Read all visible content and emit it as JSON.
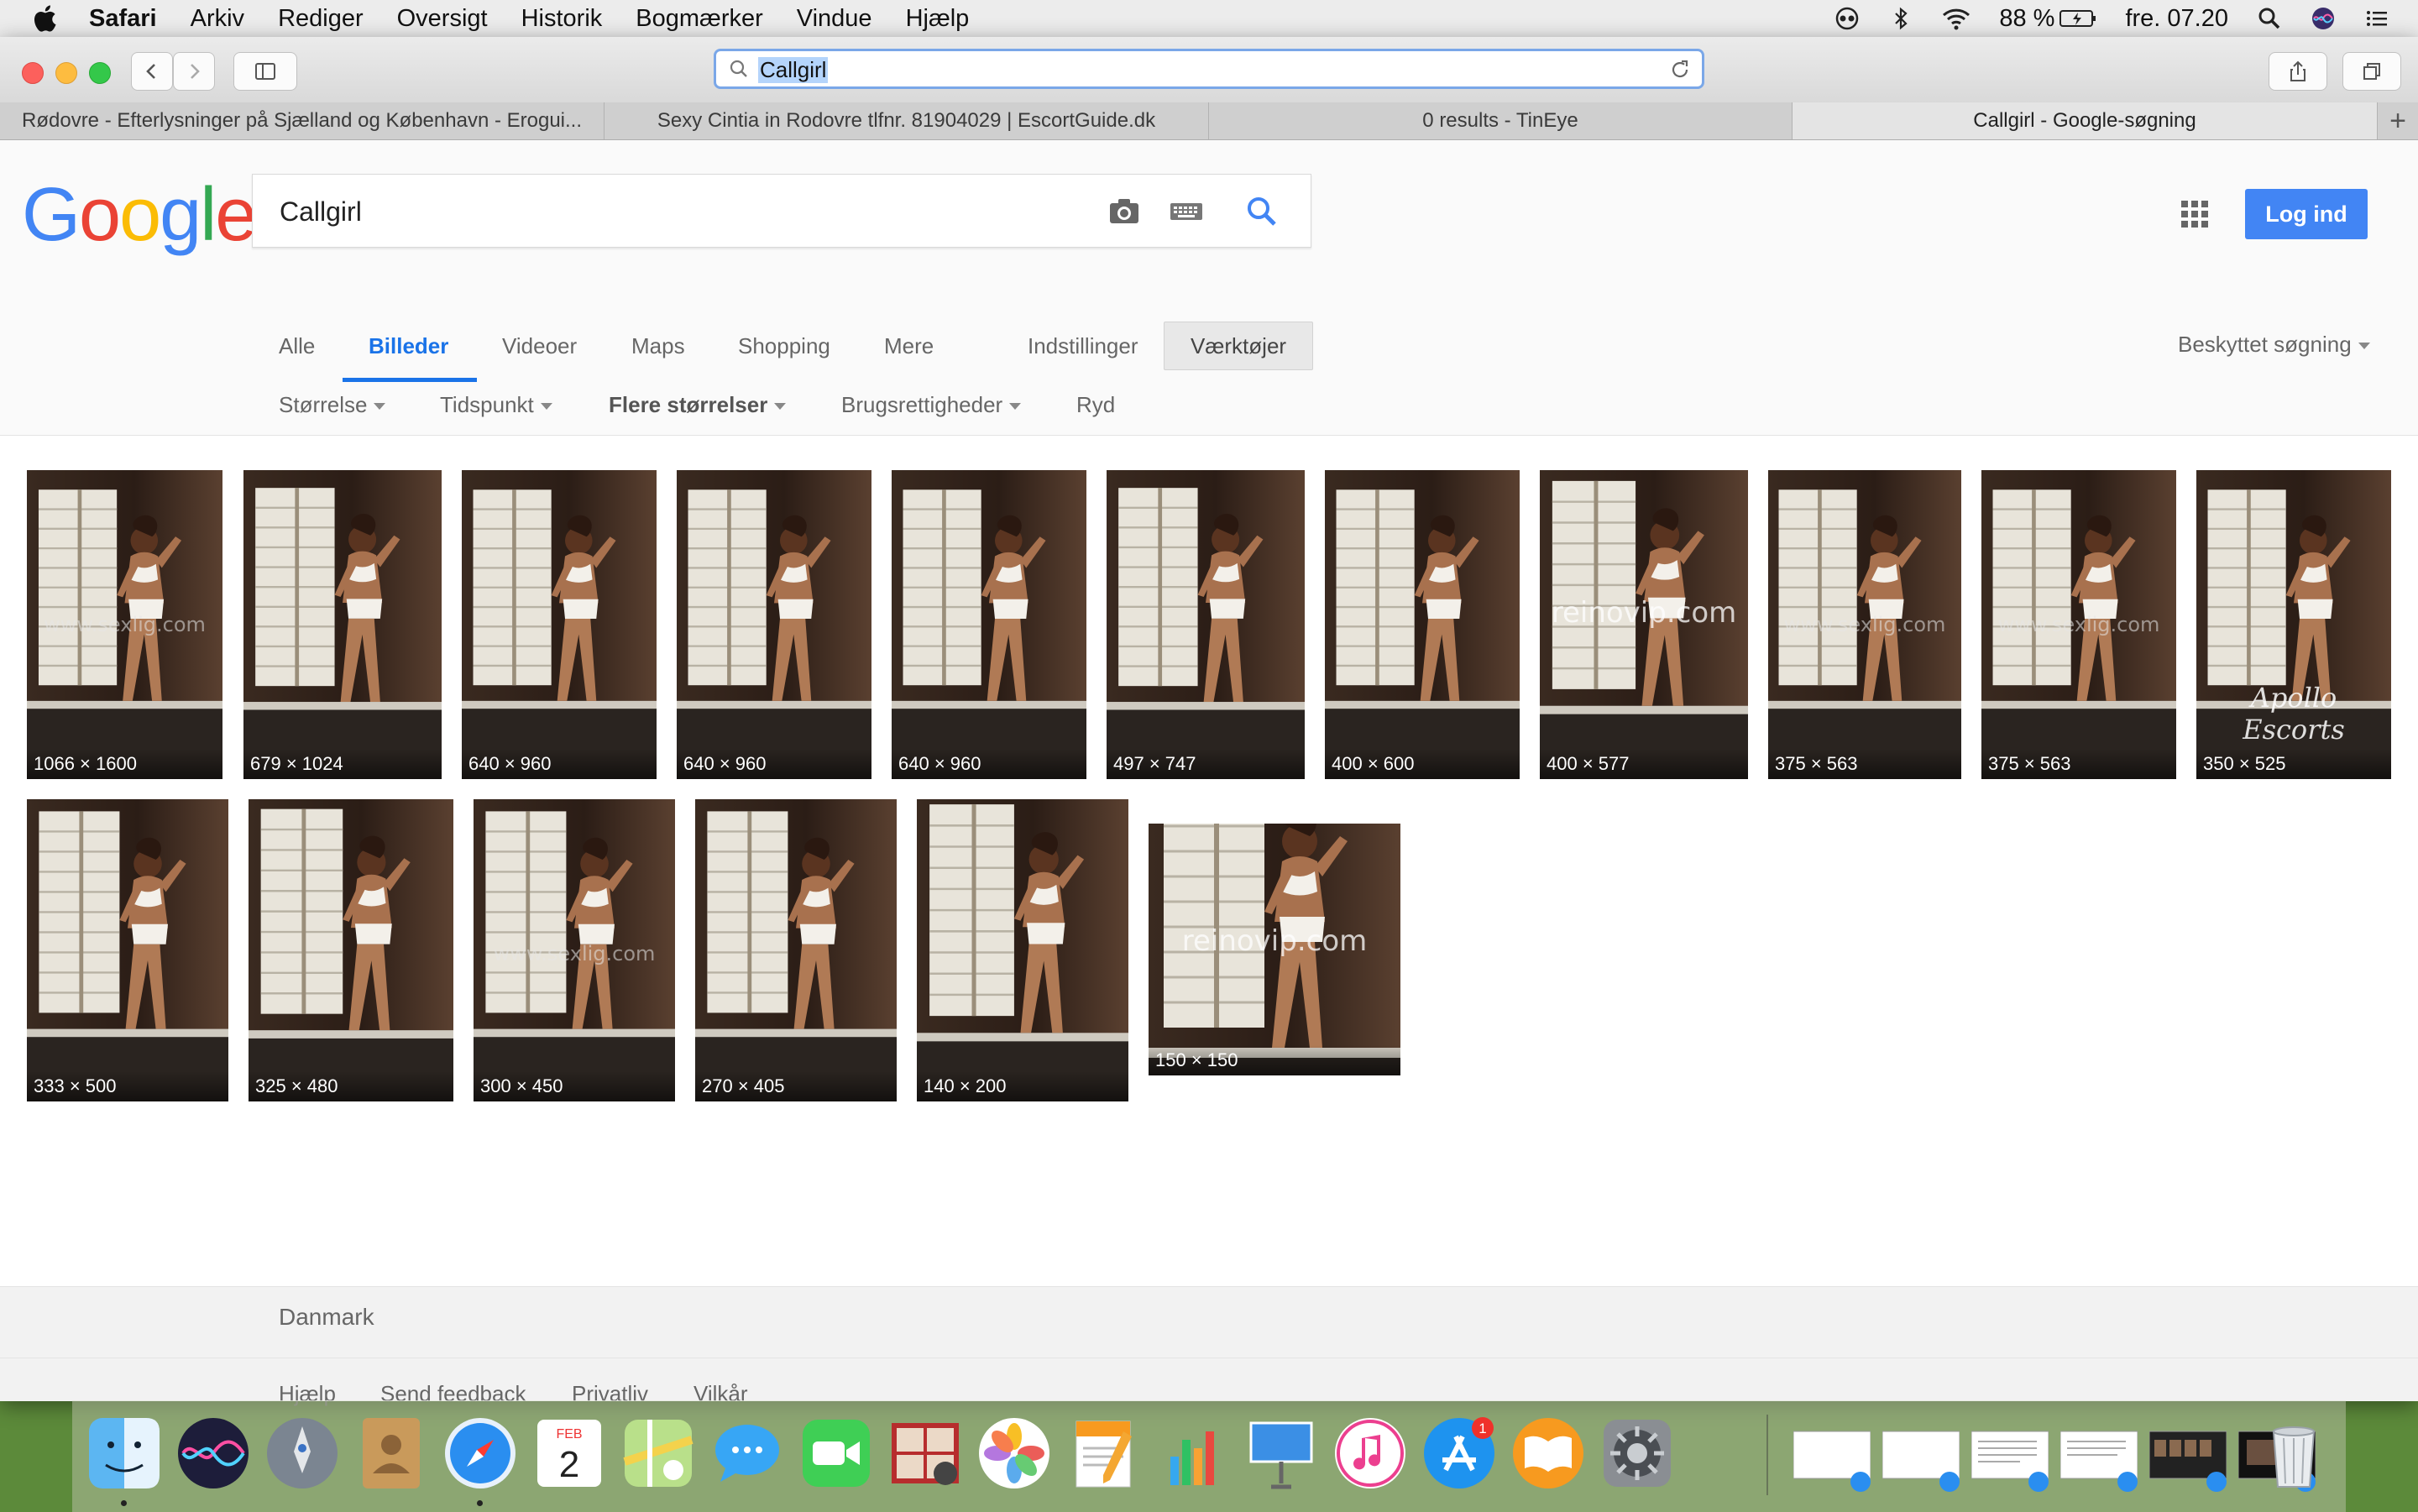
{
  "menubar": {
    "app": "Safari",
    "items": [
      "Arkiv",
      "Rediger",
      "Oversigt",
      "Historik",
      "Bogmærker",
      "Vindue",
      "Hjælp"
    ],
    "battery": "88 %",
    "clock": "fre. 07.20"
  },
  "browser": {
    "address": "Callgirl",
    "tabs": [
      "Rødovre - Efterlysninger på Sjælland og København - Erogui...",
      "Sexy Cintia in Rodovre tlfnr. 81904029 | EscortGuide.dk",
      "0 results - TinEye",
      "Callgirl - Google-søgning"
    ],
    "active_tab": 3
  },
  "google": {
    "logo": "Google",
    "query": "Callgirl",
    "login": "Log ind",
    "nav": [
      "Alle",
      "Billeder",
      "Videoer",
      "Maps",
      "Shopping",
      "Mere"
    ],
    "nav_active": "Billeder",
    "settings": "Indstillinger",
    "tools": "Værktøjer",
    "safesearch": "Beskyttet søgning",
    "filters": {
      "size": "Størrelse",
      "time": "Tidspunkt",
      "more_sizes": "Flere størrelser",
      "rights": "Brugsrettigheder",
      "clear": "Ryd"
    },
    "results": [
      {
        "dim": "1066 × 1600",
        "watermark": "www.sexlig.com"
      },
      {
        "dim": "679 × 1024",
        "watermark": ""
      },
      {
        "dim": "640 × 960",
        "watermark": ""
      },
      {
        "dim": "640 × 960",
        "watermark": ""
      },
      {
        "dim": "640 × 960",
        "watermark": ""
      },
      {
        "dim": "497 × 747",
        "watermark": ""
      },
      {
        "dim": "400 × 600",
        "watermark": ""
      },
      {
        "dim": "400 × 577",
        "watermark": "reinovip.com"
      },
      {
        "dim": "375 × 563",
        "watermark": "www.sexlig.com"
      },
      {
        "dim": "375 × 563",
        "watermark": "www.sexlig.com"
      },
      {
        "dim": "350 × 525",
        "watermark": "Apollo Escorts"
      },
      {
        "dim": "333 × 500",
        "watermark": ""
      },
      {
        "dim": "325 × 480",
        "watermark": ""
      },
      {
        "dim": "300 × 450",
        "watermark": "www.sexlig.com"
      },
      {
        "dim": "270 × 405",
        "watermark": ""
      },
      {
        "dim": "140 × 200",
        "watermark": ""
      },
      {
        "dim": "150 × 150",
        "watermark": "reinovip.com"
      }
    ],
    "footer": {
      "country": "Danmark",
      "links": [
        "Hjælp",
        "Send feedback",
        "Privatliv",
        "Vilkår"
      ]
    }
  },
  "dock": {
    "apps": [
      "finder-icon",
      "siri-icon",
      "launchpad-icon",
      "contacts-icon",
      "safari-icon",
      "calendar-icon",
      "maps-icon",
      "messages-icon",
      "facetime-icon",
      "photo-booth-icon",
      "photos-icon",
      "pages-icon",
      "numbers-icon",
      "keynote-icon",
      "itunes-icon",
      "app-store-icon",
      "ibooks-icon",
      "system-preferences-icon"
    ],
    "calendar": {
      "month": "FEB",
      "day": "2"
    },
    "app_store_badge": "1"
  },
  "colors": {
    "google_blue": "#4285f4",
    "accent_tab": "#1a73e8"
  }
}
